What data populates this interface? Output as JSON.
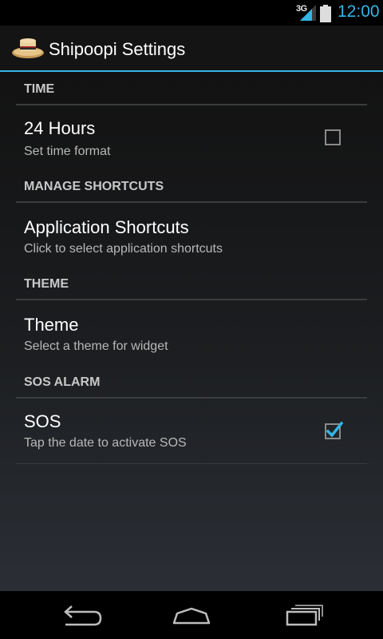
{
  "status_bar": {
    "network_type": "3G",
    "time": "12:00",
    "icons": [
      "signal-icon",
      "battery-icon"
    ]
  },
  "action_bar": {
    "title": "Shipoopi Settings",
    "icon": "straw-hat-icon"
  },
  "sections": [
    {
      "header": "TIME",
      "item": {
        "title": "24 Hours",
        "summary": "Set time format",
        "checked": false
      }
    },
    {
      "header": "MANAGE SHORTCUTS",
      "item": {
        "title": "Application Shortcuts",
        "summary": "Click to select application shortcuts"
      }
    },
    {
      "header": "THEME",
      "item": {
        "title": "Theme",
        "summary": "Select a theme for widget"
      }
    },
    {
      "header": "SOS ALARM",
      "item": {
        "title": "SOS",
        "summary": "Tap the date to activate SOS",
        "checked": true
      }
    }
  ],
  "nav_bar": {
    "buttons": [
      "back-icon",
      "home-icon",
      "recents-icon"
    ]
  },
  "colors": {
    "accent": "#33b5e5",
    "background_top": "#121212",
    "background_bottom": "#2b2f35",
    "divider": "#3c3c3c"
  }
}
